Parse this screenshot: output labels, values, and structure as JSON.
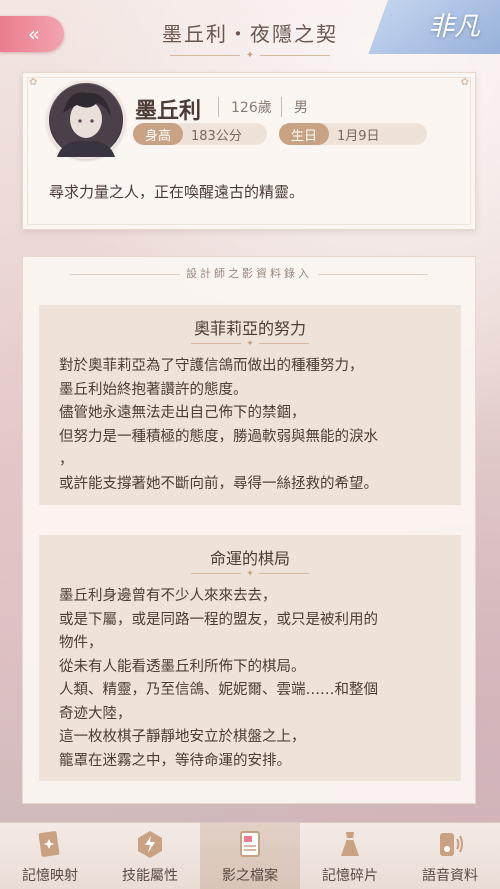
{
  "header": {
    "title": "墨丘利・夜隱之契",
    "back_glyph": "«",
    "rarity": "非凡"
  },
  "profile": {
    "name": "墨丘利",
    "age": "126歲",
    "gender": "男",
    "height_label": "身高",
    "height_value": "183公分",
    "birthday_label": "生日",
    "birthday_value": "1月9日",
    "bio": "尋求力量之人，正在喚醒遠古的精靈。"
  },
  "records": {
    "heading": "設計師之影資料錄入",
    "entries": [
      {
        "title": "奧菲莉亞的努力",
        "lines": [
          "對於奧菲莉亞為了守護信鴿而做出的種種努力，",
          "墨丘利始終抱著讚許的態度。",
          "儘管她永遠無法走出自己佈下的禁錮，",
          "但努力是一種積極的態度，勝過軟弱與無能的淚水",
          "，",
          "或許能支撐著她不斷向前，尋得一絲拯救的希望。"
        ]
      },
      {
        "title": "命運的棋局",
        "lines": [
          "墨丘利身邊曾有不少人來來去去，",
          "或是下屬，或是同路一程的盟友，或只是被利用的",
          "物件，",
          "從未有人能看透墨丘利所佈下的棋局。",
          "人類、精靈，乃至信鴿、妮妮爾、雲端……和整個",
          "奇迹大陸，",
          "這一枚枚棋子靜靜地安立於棋盤之上，",
          "籠罩在迷霧之中，等待命運的安排。"
        ]
      }
    ]
  },
  "nav": [
    {
      "label": "記憶映射",
      "icon": "memory-card-icon",
      "active": false
    },
    {
      "label": "技能屬性",
      "icon": "skill-hexagon-icon",
      "active": false
    },
    {
      "label": "影之檔案",
      "icon": "document-icon",
      "active": true
    },
    {
      "label": "記憶碎片",
      "icon": "dress-icon",
      "active": false
    },
    {
      "label": "語音資料",
      "icon": "voice-phone-icon",
      "active": false
    }
  ],
  "colors": {
    "accent_pink": "#ea7d8e",
    "tag_brown": "#c9a183",
    "panel": "#fbf6f2"
  }
}
